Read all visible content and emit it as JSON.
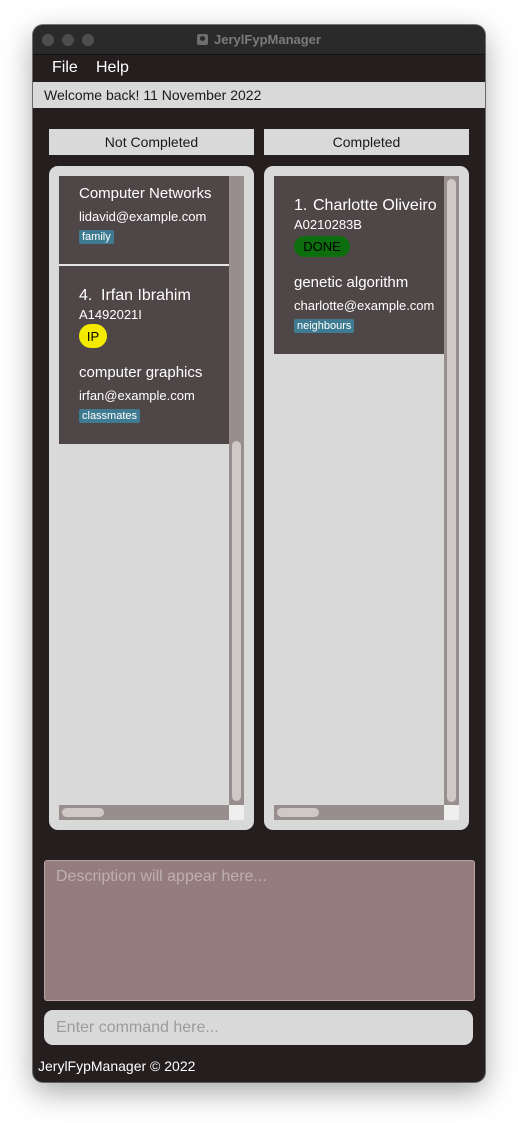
{
  "window": {
    "title": "JerylFypManager"
  },
  "menu": {
    "file": "File",
    "help": "Help"
  },
  "welcome": "Welcome back! 11 November 2022",
  "columns": {
    "not_completed": "Not Completed",
    "completed": "Completed"
  },
  "not_completed_cards": [
    {
      "project": "Computer Networks",
      "email": "lidavid@example.com",
      "tag": "family"
    },
    {
      "index": "4.",
      "name": "Irfan Ibrahim",
      "student_id": "A1492021I",
      "status": "IP",
      "project": "computer graphics",
      "email": "irfan@example.com",
      "tag": "classmates"
    }
  ],
  "completed_cards": [
    {
      "index": "1.",
      "name": "Charlotte Oliveiro",
      "student_id": "A0210283B",
      "status": "DONE",
      "project": "genetic algorithm",
      "email": "charlotte@example.com",
      "tag": "neighbours"
    }
  ],
  "description": {
    "placeholder": "Description will appear here..."
  },
  "command": {
    "placeholder": "Enter command here...",
    "value": ""
  },
  "footer": "JerylFypManager © 2022",
  "colors": {
    "window_bg": "#241e1f",
    "card_bg": "#4f4747",
    "tag_bg": "#3e7b91",
    "status_ip": "#f3ea00",
    "status_done": "#0c6e0c",
    "description_bg": "#967d7d"
  }
}
